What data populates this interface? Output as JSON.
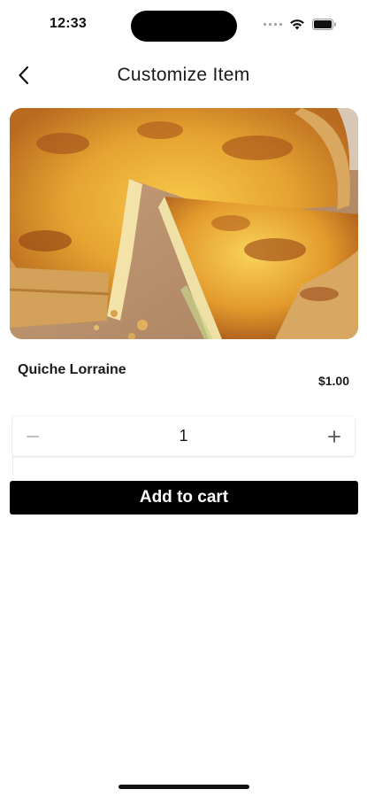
{
  "status_bar": {
    "time": "12:33",
    "icons": [
      "signal-dots-icon",
      "wifi-icon",
      "battery-icon"
    ]
  },
  "header": {
    "back_icon": "chevron-left-icon",
    "title": "Customize Item"
  },
  "item": {
    "image_alt": "quiche-photo",
    "name": "Quiche Lorraine",
    "price": "$1.00"
  },
  "quantity": {
    "value": "1",
    "minus_icon": "minus-icon",
    "plus_icon": "plus-icon"
  },
  "actions": {
    "add_to_cart_label": "Add to cart"
  },
  "colors": {
    "primary_button": "#000000",
    "button_text": "#ffffff",
    "background": "#ffffff"
  }
}
